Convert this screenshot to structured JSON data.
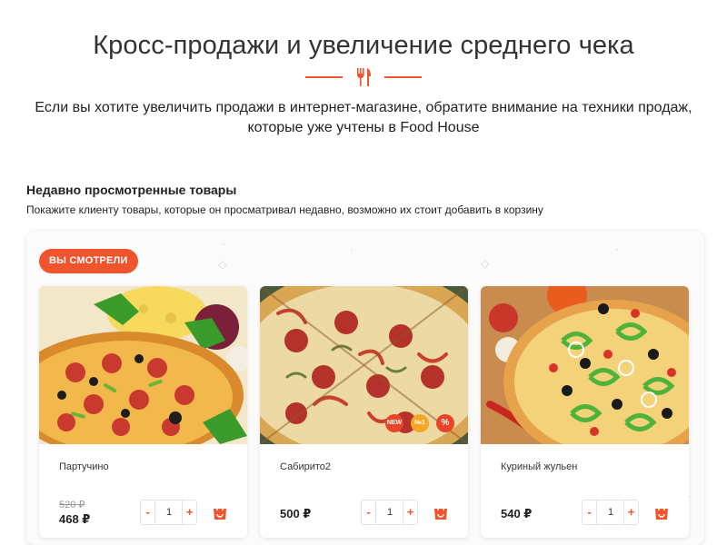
{
  "header": {
    "title": "Кросс-продажи и увеличение среднего чека",
    "intro": "Если вы хотите увеличить продажи в интернет-магазине, обратите внимание на техники продаж, которые уже учтены в Food House",
    "divider_icon": "fork-knife-icon"
  },
  "section": {
    "title": "Недавно просмотренные товары",
    "subtitle": "Покажите клиенту товары, которые он просматривал недавно, возможно их стоит добавить в корзину",
    "badge": "ВЫ СМОТРЕЛИ"
  },
  "products": [
    {
      "name": "Партучино",
      "old_price": "520 ₽",
      "price": "468 ₽",
      "qty": "1",
      "badges": []
    },
    {
      "name": "Сабирито2",
      "price": "500 ₽",
      "qty": "1",
      "badges": [
        "NEW",
        "№1",
        "%"
      ]
    },
    {
      "name": "Куриный жульен",
      "price": "540 ₽",
      "qty": "1",
      "badges": []
    }
  ],
  "controls": {
    "minus": "-",
    "plus": "+",
    "cart_icon": "shopping-bag-icon"
  },
  "colors": {
    "accent": "#f0542d",
    "badge_new": "#e8442a",
    "badge_top": "#f5a623",
    "badge_sale": "#e8442a"
  }
}
